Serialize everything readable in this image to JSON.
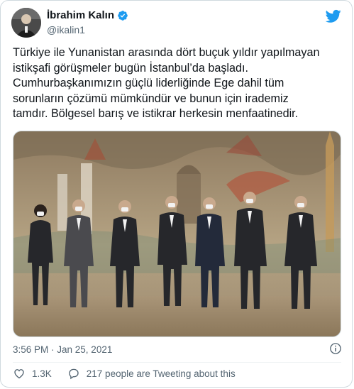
{
  "author": {
    "name": "İbrahim Kalın",
    "handle": "@ikalin1"
  },
  "tweet": {
    "lines": [
      "Türkiye ile Yunanistan arasında dört buçuk yıldır yapılmayan",
      "istikşafi görüşmeler bugün İstanbul’da başladı.",
      "Cumhurbaşkanımızın güçlü liderliğinde Ege dahil tüm",
      "sorunların çözümü mümkündür ve bunun için irademiz",
      "tamdır. Bölgesel barış ve istikrar herkesin menfaatinedir."
    ]
  },
  "meta": {
    "timestamp": "3:56 PM · Jan 25, 2021"
  },
  "actions": {
    "like_count": "1.3K",
    "reply_text": "217 people are Tweeting about this"
  },
  "colors": {
    "brand": "#1d9bf0",
    "text": "#0f1419",
    "secondary": "#536471",
    "like": "#f91880"
  },
  "icons": {
    "platform": "bird-logo-icon",
    "verified": "verified-badge-icon",
    "info": "info-icon",
    "like": "heart-icon",
    "reply": "speech-bubble-icon"
  }
}
